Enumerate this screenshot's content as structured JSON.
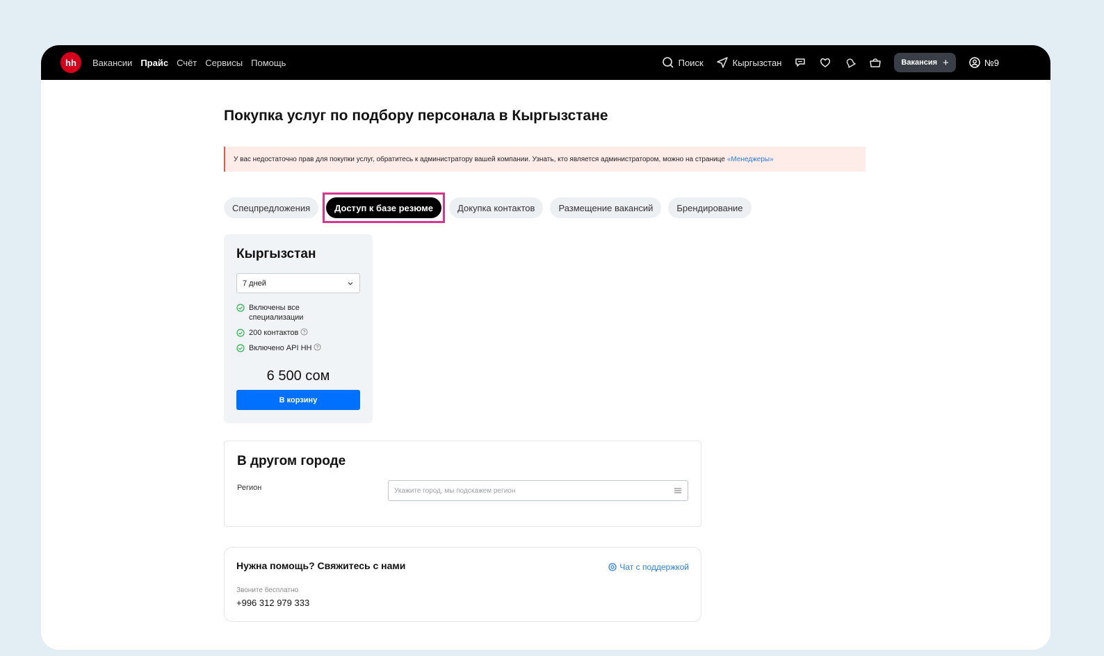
{
  "navbar": {
    "logo": "hh",
    "links": [
      "Вакансии",
      "Прайс",
      "Счёт",
      "Сервисы",
      "Помощь"
    ],
    "search_label": "Поиск",
    "region_label": "Кыргызстан",
    "vacancy_button": "Вакансия",
    "vacancy_plus": "+",
    "account_label": "№9"
  },
  "page": {
    "title": "Покупка услуг по подбору персонала в Кыргызстане",
    "alert_text": "У вас недостаточно прав для покупки услуг, обратитесь к администратору вашей компании. Узнать, кто является администратором, можно на странице",
    "alert_link": "«Менеджеры»"
  },
  "tabs": [
    {
      "label": "Спецпредложения",
      "active": false
    },
    {
      "label": "Доступ к базе резюме",
      "active": true
    },
    {
      "label": "Докупка контактов",
      "active": false
    },
    {
      "label": "Размещение вакансий",
      "active": false
    },
    {
      "label": "Брендирование",
      "active": false
    }
  ],
  "card": {
    "title": "Кыргызстан",
    "duration_selected": "7 дней",
    "features": [
      "Включены все специализации",
      "200 контактов",
      "Включено API HH"
    ],
    "price": "6 500 сом",
    "cart_button": "В корзину"
  },
  "other_city": {
    "title": "В другом городе",
    "region_label": "Регион",
    "region_placeholder": "Укажите город, мы подскажем регион"
  },
  "help": {
    "title": "Нужна помощь? Свяжитесь с нами",
    "support_link": "Чат с поддержкой",
    "call_label": "Звоните бесплатно",
    "phone": "+996 312 979 333"
  },
  "colors": {
    "background": "#e3eef4",
    "navbar": "#000000",
    "brand_red": "#d6001c",
    "primary_blue": "#0070ff",
    "link_blue": "#2b7de9",
    "highlight_pink": "#d6378f",
    "alert_bg": "#fdece8",
    "check_green": "#2bb34a"
  }
}
